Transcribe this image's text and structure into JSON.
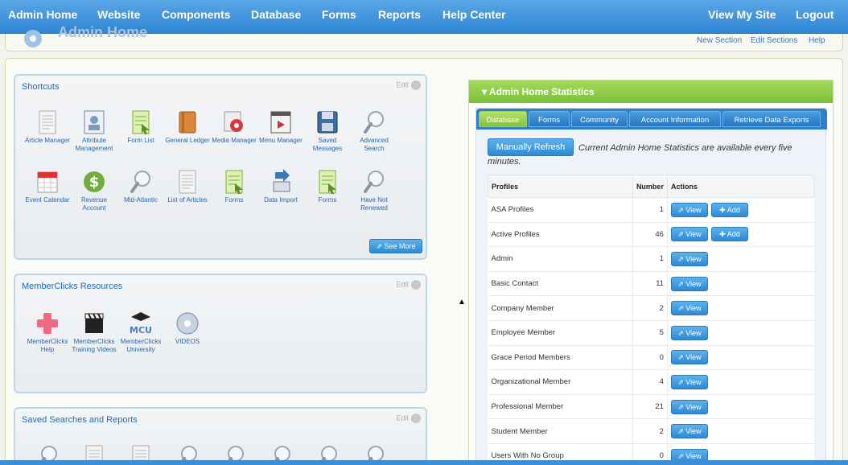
{
  "nav": {
    "items": [
      "Admin Home",
      "Website",
      "Components",
      "Database",
      "Forms",
      "Reports",
      "Help Center"
    ],
    "right_items": [
      "View My Site",
      "Logout"
    ]
  },
  "header": {
    "title": "Admin Home",
    "links": [
      "New Section",
      "Edit Sections",
      "Help"
    ]
  },
  "shortcuts": {
    "title": "Shortcuts",
    "edit": "Edit",
    "items": [
      {
        "label": "Article Manager",
        "icon": "document-icon"
      },
      {
        "label": "Attribute Management",
        "icon": "profile-card-icon"
      },
      {
        "label": "Form List",
        "icon": "form-icon"
      },
      {
        "label": "General Ledger",
        "icon": "ledger-icon"
      },
      {
        "label": "Media Manager",
        "icon": "media-icon"
      },
      {
        "label": "Menu Manager",
        "icon": "menu-icon"
      },
      {
        "label": "Saved Messages",
        "icon": "floppy-disk-icon"
      },
      {
        "label": "Advanced Search",
        "icon": "magnifier-icon"
      },
      {
        "label": "Event Calendar",
        "icon": "calendar-icon"
      },
      {
        "label": "Revenue Account",
        "icon": "dollar-icon"
      },
      {
        "label": "Mid-Atlantic",
        "icon": "magnifier-icon"
      },
      {
        "label": "List of Articles",
        "icon": "document-icon"
      },
      {
        "label": "Forms",
        "icon": "form-icon"
      },
      {
        "label": "Data Import",
        "icon": "import-icon"
      },
      {
        "label": "Forms",
        "icon": "form-icon"
      },
      {
        "label": "Have Not Renewed",
        "icon": "magnifier-icon"
      }
    ],
    "see_more": "See More"
  },
  "resources": {
    "title": "MemberClicks Resources",
    "edit": "Edit",
    "items": [
      {
        "label": "MemberClicks Help",
        "icon": "help-cross-icon"
      },
      {
        "label": "MemberClicks Training Videos",
        "icon": "clapperboard-icon"
      },
      {
        "label": "MemberClicks University",
        "icon": "university-icon"
      },
      {
        "label": "VIDEOS",
        "icon": "video-disc-icon"
      }
    ]
  },
  "saved_searches": {
    "title": "Saved Searches and Reports",
    "edit": "Edit"
  },
  "stats": {
    "title": "Admin Home Statistics",
    "tabs": [
      "Database",
      "Forms",
      "Community",
      "Account Information",
      "Retrieve Data Exports"
    ],
    "active_tab": "Database",
    "refresh_label": "Manually Refresh",
    "refresh_note": "Current Admin Home Statistics are available every five minutes.",
    "columns": [
      "Profiles",
      "Number",
      "Actions"
    ],
    "view_label": "View",
    "add_label": "Add",
    "rows": [
      {
        "profile": "ASA Profiles",
        "number": "1",
        "add": true
      },
      {
        "profile": "Active Profiles",
        "number": "46",
        "add": true
      },
      {
        "profile": "Admin",
        "number": "1",
        "add": false
      },
      {
        "profile": "Basic Contact",
        "number": "11",
        "add": false
      },
      {
        "profile": "Company Member",
        "number": "2",
        "add": false
      },
      {
        "profile": "Employee Member",
        "number": "5",
        "add": false
      },
      {
        "profile": "Grace Period Members",
        "number": "0",
        "add": false
      },
      {
        "profile": "Organizational Member",
        "number": "4",
        "add": false
      },
      {
        "profile": "Professional Member",
        "number": "21",
        "add": false
      },
      {
        "profile": "Student Member",
        "number": "2",
        "add": false
      },
      {
        "profile": "Users With No Group",
        "number": "0",
        "add": false
      }
    ]
  },
  "colors": {
    "nav_blue": "#2f86d4",
    "accent_green": "#86c241",
    "button_blue": "#2b8ad6"
  }
}
